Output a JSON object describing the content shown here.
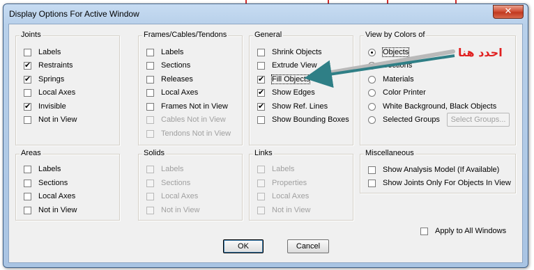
{
  "window": {
    "title": "Display Options For Active Window",
    "close_glyph": "✕"
  },
  "groups": {
    "joints": {
      "label": "Joints",
      "items": [
        {
          "label": "Labels",
          "checked": false
        },
        {
          "label": "Restraints",
          "checked": true
        },
        {
          "label": "Springs",
          "checked": true
        },
        {
          "label": "Local Axes",
          "checked": false
        },
        {
          "label": "Invisible",
          "checked": true
        },
        {
          "label": "Not in View",
          "checked": false
        }
      ]
    },
    "frames": {
      "label": "Frames/Cables/Tendons",
      "items": [
        {
          "label": "Labels",
          "checked": false
        },
        {
          "label": "Sections",
          "checked": false
        },
        {
          "label": "Releases",
          "checked": false
        },
        {
          "label": "Local Axes",
          "checked": false
        },
        {
          "label": "Frames Not in View",
          "checked": false
        },
        {
          "label": "Cables Not in View",
          "checked": false,
          "disabled": true
        },
        {
          "label": "Tendons Not in View",
          "checked": false,
          "disabled": true
        }
      ]
    },
    "general": {
      "label": "General",
      "items": [
        {
          "label": "Shrink Objects",
          "checked": false
        },
        {
          "label": "Extrude View",
          "checked": false
        },
        {
          "label": "Fill Objects",
          "checked": true
        },
        {
          "label": "Show Edges",
          "checked": true
        },
        {
          "label": "Show Ref. Lines",
          "checked": true
        },
        {
          "label": "Show Bounding Boxes",
          "checked": false
        }
      ]
    },
    "view_by_colors": {
      "label": "View by Colors of",
      "options": [
        {
          "label": "Objects",
          "selected": true
        },
        {
          "label": "Sections",
          "selected": false
        },
        {
          "label": "Materials",
          "selected": false
        },
        {
          "label": "Color Printer",
          "selected": false
        },
        {
          "label": "White Background, Black Objects",
          "selected": false
        },
        {
          "label": "Selected Groups",
          "selected": false
        }
      ],
      "select_groups_button": "Select Groups..."
    },
    "areas": {
      "label": "Areas",
      "items": [
        {
          "label": "Labels",
          "checked": false
        },
        {
          "label": "Sections",
          "checked": false
        },
        {
          "label": "Local Axes",
          "checked": false
        },
        {
          "label": "Not in View",
          "checked": false
        }
      ]
    },
    "solids": {
      "label": "Solids",
      "items": [
        {
          "label": "Labels",
          "checked": false,
          "disabled": true
        },
        {
          "label": "Sections",
          "checked": false,
          "disabled": true
        },
        {
          "label": "Local Axes",
          "checked": false,
          "disabled": true
        },
        {
          "label": "Not in View",
          "checked": false,
          "disabled": true
        }
      ]
    },
    "links": {
      "label": "Links",
      "items": [
        {
          "label": "Labels",
          "checked": false,
          "disabled": true
        },
        {
          "label": "Properties",
          "checked": false,
          "disabled": true
        },
        {
          "label": "Local Axes",
          "checked": false,
          "disabled": true
        },
        {
          "label": "Not in View",
          "checked": false,
          "disabled": true
        }
      ]
    },
    "misc": {
      "label": "Miscellaneous",
      "items": [
        {
          "label": "Show Analysis Model  (If Available)",
          "checked": false
        },
        {
          "label": "Show Joints Only For Objects In View",
          "checked": false
        }
      ]
    }
  },
  "apply_all": {
    "label": "Apply to All Windows",
    "checked": false
  },
  "buttons": {
    "ok": "OK",
    "cancel": "Cancel"
  },
  "annotation": {
    "text": "احدد هنا",
    "color": "#e02020",
    "arrow_color": "#2f7f86"
  }
}
